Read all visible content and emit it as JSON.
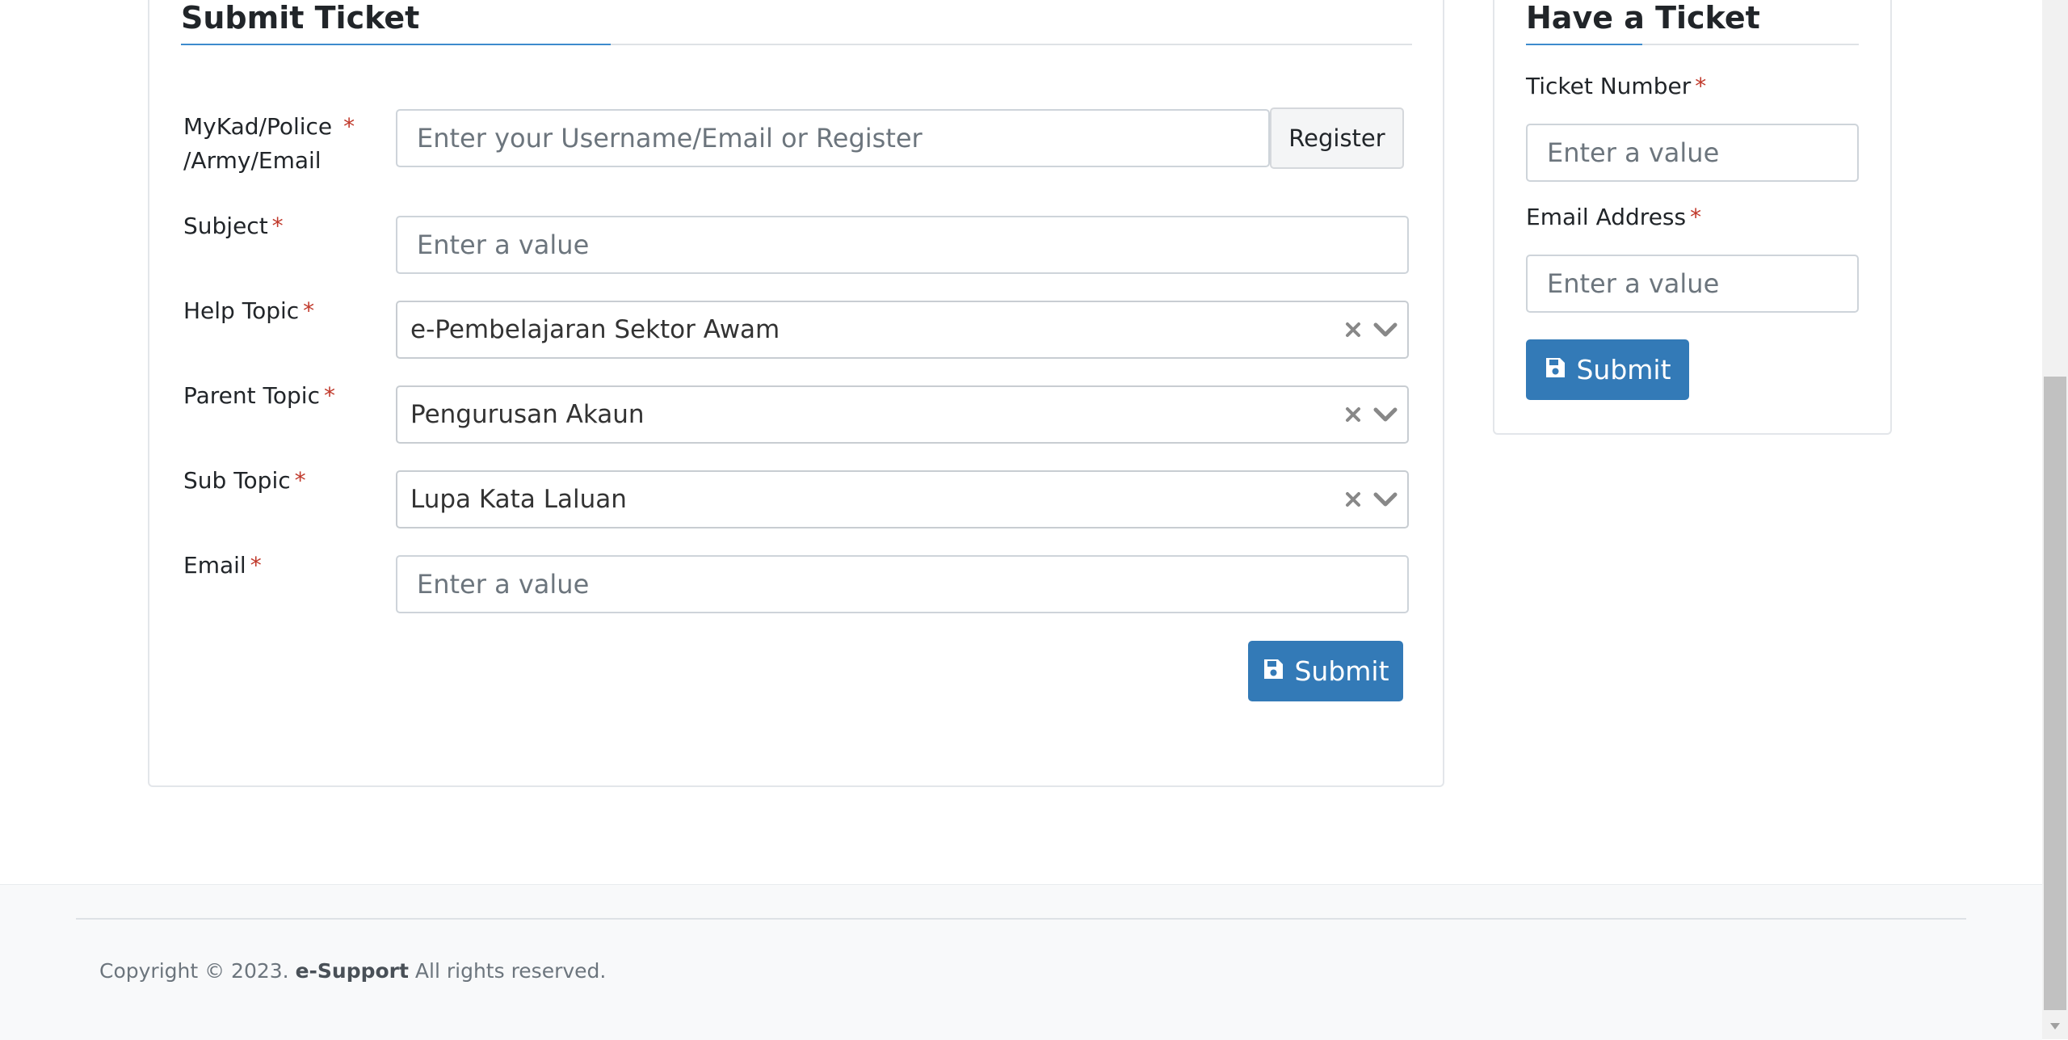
{
  "submit_ticket": {
    "title": "Submit Ticket",
    "mykad_label": "MyKad/Police",
    "mykad_label_line2": "/Army/Email",
    "mykad_placeholder": "Enter your Username/Email or Register",
    "register_label": "Register",
    "subject_label": "Subject",
    "subject_placeholder": "Enter a value",
    "help_topic_label": "Help Topic",
    "help_topic_value": "e-Pembelajaran Sektor Awam",
    "parent_topic_label": "Parent Topic",
    "parent_topic_value": "Pengurusan Akaun",
    "sub_topic_label": "Sub Topic",
    "sub_topic_value": "Lupa Kata Laluan",
    "email_label": "Email",
    "email_placeholder": "Enter a value",
    "submit_label": "Submit",
    "required_marker": "*"
  },
  "have_ticket": {
    "title": "Have a Ticket",
    "ticket_number_label": "Ticket Number",
    "ticket_number_placeholder": "Enter a value",
    "email_label": "Email Address",
    "email_placeholder": "Enter a value",
    "submit_label": "Submit"
  },
  "footer": {
    "copyright_prefix": "Copyright © 2023.",
    "brand": "e-Support",
    "copyright_suffix": "All rights reserved."
  },
  "colors": {
    "primary": "#337ab7",
    "accent_line": "#3d8bcd",
    "required": "#c0392b"
  },
  "icons": {
    "save": "floppy-disk-icon",
    "clear": "close-icon",
    "dropdown": "chevron-down-icon"
  }
}
